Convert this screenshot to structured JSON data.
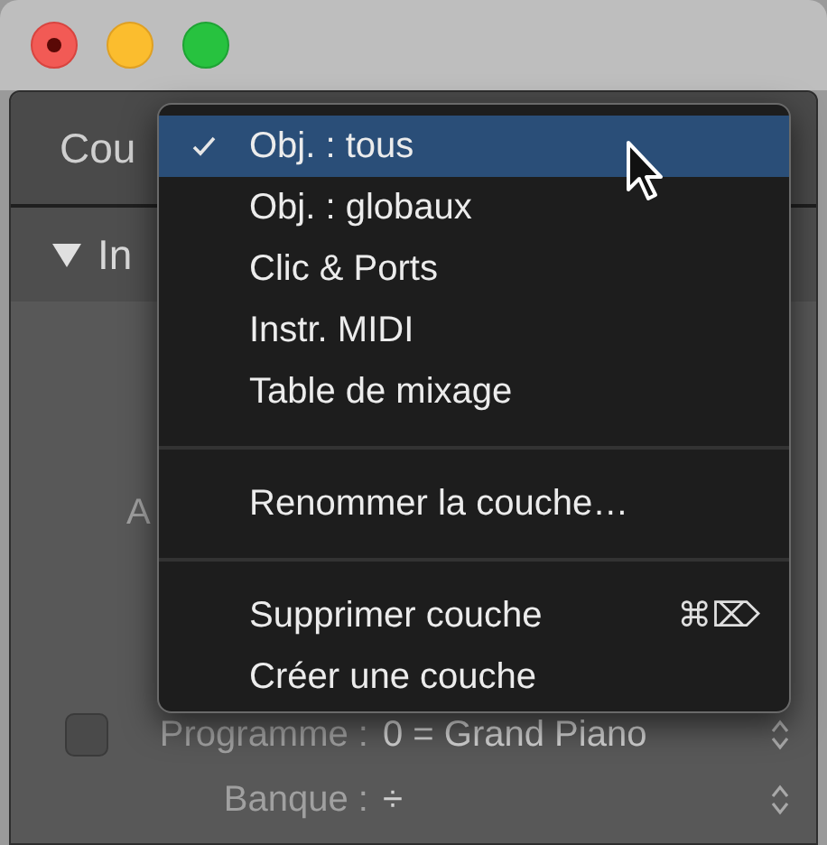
{
  "panel": {
    "header_label": "Cou",
    "section": {
      "label": "In",
      "expanded": true
    },
    "body_label": "A",
    "rows": [
      {
        "kind": "checkbox",
        "checked": false,
        "label": "Programme :",
        "value": "0 = Grand Piano"
      },
      {
        "kind": "plain",
        "label": "Banque :",
        "value": "÷"
      }
    ]
  },
  "menu": {
    "groups": [
      [
        {
          "label": "Obj. : tous",
          "checked": true,
          "selected": true
        },
        {
          "label": "Obj. : globaux",
          "checked": false,
          "selected": false
        },
        {
          "label": "Clic & Ports",
          "checked": false,
          "selected": false
        },
        {
          "label": "Instr. MIDI",
          "checked": false,
          "selected": false
        },
        {
          "label": "Table de mixage",
          "checked": false,
          "selected": false
        }
      ],
      [
        {
          "label": "Renommer la couche…",
          "checked": false,
          "selected": false
        }
      ],
      [
        {
          "label": "Supprimer couche",
          "shortcut": "⌘⌦",
          "checked": false,
          "selected": false
        },
        {
          "label": "Créer une couche",
          "checked": false,
          "selected": false
        }
      ]
    ]
  }
}
